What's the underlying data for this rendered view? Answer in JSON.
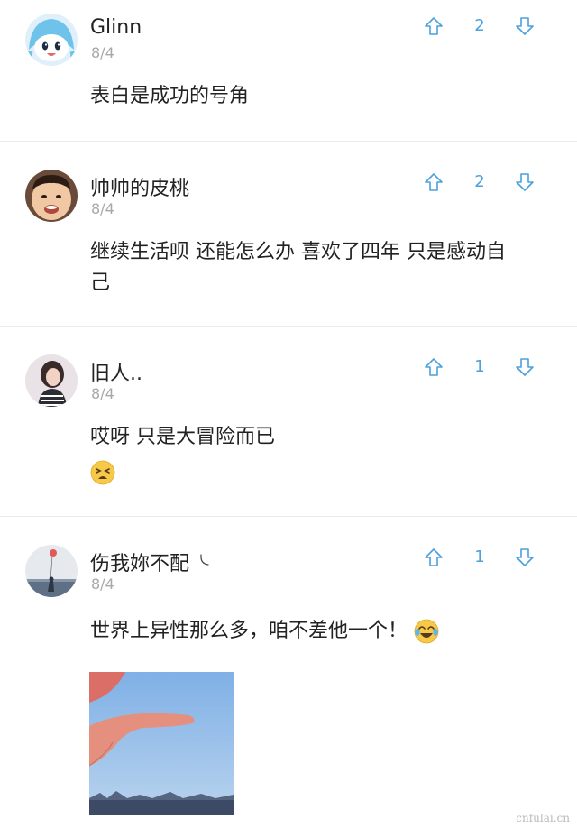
{
  "comments": [
    {
      "username": "Glinn",
      "date": "8/4",
      "votes": "2",
      "text": "表白是成功的号角",
      "avatar": "cartoon-squid-girl-avatar"
    },
    {
      "username": "帅帅的皮桃",
      "date": "8/4",
      "votes": "2",
      "text_line1": "继续生活呗 还能怎么办 喜欢了四年 只是感动自",
      "text_line2": "己",
      "avatar": "child-photo-avatar"
    },
    {
      "username": "旧人..",
      "date": "8/4",
      "votes": "1",
      "text": "哎呀 只是大冒险而已",
      "emoji": "tired-face-emoji",
      "avatar": "girl-photo-avatar"
    },
    {
      "username": "伤我妳不配",
      "date": "8/4",
      "votes": "1",
      "text": "世界上异性那么多，咱不差他一个！",
      "emoji": "tears-of-joy-emoji",
      "avatar": "balloon-photo-avatar",
      "image": "peace-sign-hand-sky-photo"
    }
  ],
  "colors": {
    "accent": "#4ca0dc",
    "text": "#222222",
    "muted": "#a8a8a8",
    "divider": "#ebebeb"
  },
  "icons": {
    "upvote": "arrow-up-outline-icon",
    "downvote": "arrow-down-outline-icon"
  },
  "watermark": "cnfulai.cn"
}
